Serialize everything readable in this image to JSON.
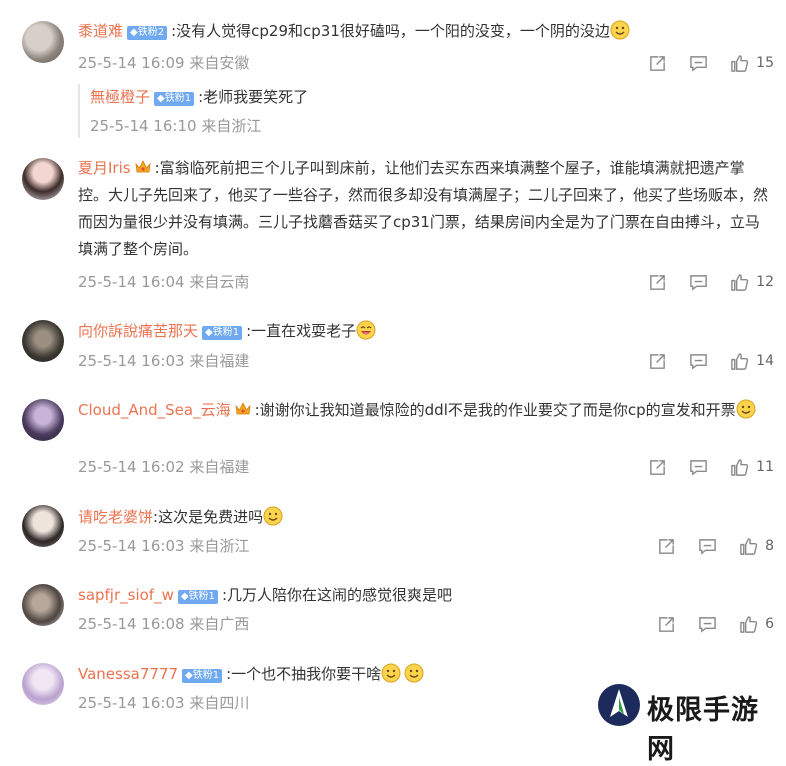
{
  "comments": [
    {
      "username": "黍道难",
      "badge": "铁粉2",
      "text": ":没有人觉得cp29和cp31很好磕吗，一个阳的没变，一个阴的没边",
      "timestamp": "25-5-14 16:09",
      "location": "来自安徽",
      "likes": "15",
      "reply": {
        "username": "無極橙子",
        "badge": "铁粉1",
        "text": ":老师我要笑死了",
        "timestamp": "25-5-14 16:10",
        "location": "来自浙江"
      }
    },
    {
      "username": "夏月Iris",
      "text": ":富翁临死前把三个儿子叫到床前，让他们去买东西来填满整个屋子，谁能填满就把遗产掌控。大儿子先回来了，他买了一些谷子，然而很多却没有填满屋子；二儿子回来了，他买了些场贩本，然而因为量很少并没有填满。三儿子找蘑香菇买了cp31门票，结果房间内全是为了门票在自由搏斗，立马填满了整个房间。",
      "timestamp": "25-5-14 16:04",
      "location": "来自云南",
      "likes": "12"
    },
    {
      "username": "向你訴說痛苦那天",
      "badge": "铁粉1",
      "text": ":一直在戏耍老子",
      "timestamp": "25-5-14 16:03",
      "location": "来自福建",
      "likes": "14"
    },
    {
      "username": "Cloud_And_Sea_云海",
      "text": ":谢谢你让我知道最惊险的ddl不是我的作业要交了而是你cp的宣发和开票",
      "timestamp": "25-5-14 16:02",
      "location": "来自福建",
      "likes": "11"
    },
    {
      "username": "请吃老婆饼",
      "text": ":这次是免费进吗",
      "timestamp": "25-5-14 16:03",
      "location": "来自浙江",
      "likes": "8"
    },
    {
      "username": "sapfjr_siof_w",
      "badge": "铁粉1",
      "text": ":几万人陪你在这闹的感觉很爽是吧",
      "timestamp": "25-5-14 16:08",
      "location": "来自广西",
      "likes": "6"
    },
    {
      "username": "Vanessa7777",
      "badge": "铁粉1",
      "text": ":一个也不抽我你要干啥",
      "timestamp": "25-5-14 16:03",
      "location": "来自四川"
    }
  ],
  "watermark": "极限手游网",
  "colors": {
    "username": "#eb7350",
    "badge": "#6fa9f2",
    "meta": "#999999",
    "text": "#333333"
  }
}
